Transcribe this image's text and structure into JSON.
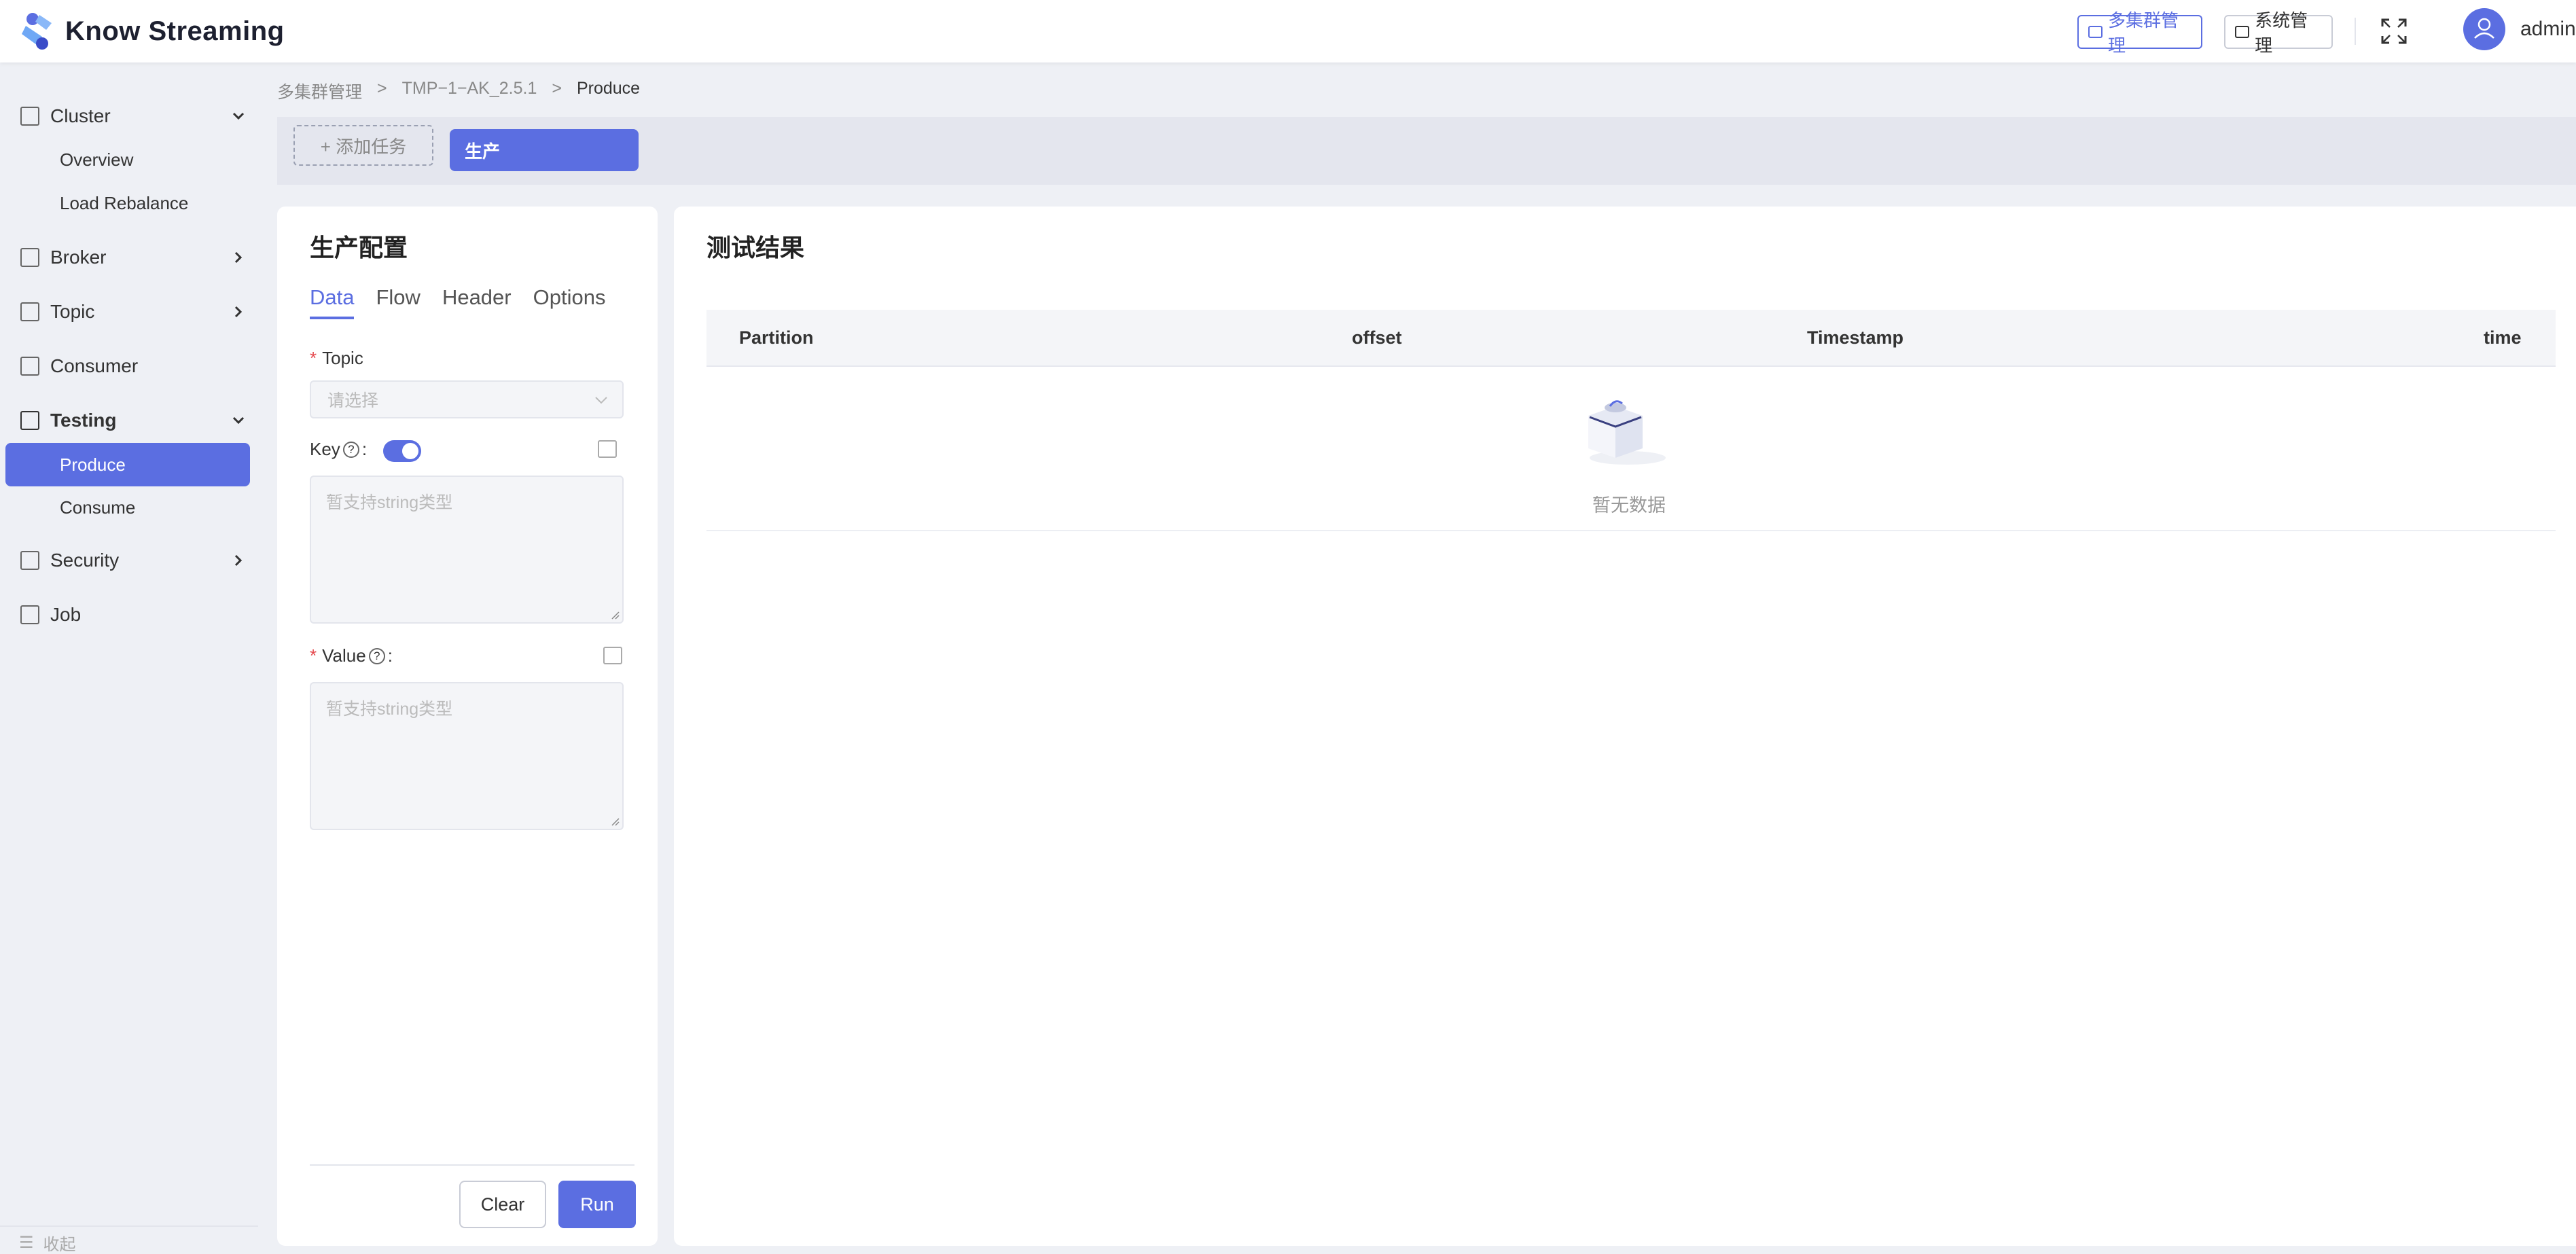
{
  "app": {
    "name": "Know Streaming"
  },
  "header": {
    "multi_cluster_btn": "多集群管理",
    "system_btn": "系统管理",
    "user": "admin"
  },
  "colors": {
    "accent": "#5b6ee1",
    "background": "#eef0f5"
  },
  "sidebar": {
    "items": [
      {
        "label": "Cluster",
        "icon": "cluster-icon",
        "expanded": true
      },
      {
        "label": "Overview"
      },
      {
        "label": "Load Rebalance"
      },
      {
        "label": "Broker",
        "icon": "broker-icon",
        "expanded": false
      },
      {
        "label": "Topic",
        "icon": "topic-icon",
        "expanded": false
      },
      {
        "label": "Consumer",
        "icon": "consumer-icon"
      },
      {
        "label": "Testing",
        "icon": "testing-icon",
        "expanded": true
      },
      {
        "label": "Produce",
        "active": true
      },
      {
        "label": "Consume"
      },
      {
        "label": "Security",
        "icon": "security-icon",
        "expanded": false
      },
      {
        "label": "Job",
        "icon": "job-icon"
      }
    ],
    "collapse_label": "收起"
  },
  "breadcrumb": {
    "items": [
      "多集群管理",
      ">",
      "TMP−1−AK_2.5.1",
      ">",
      "Produce"
    ]
  },
  "tasks": {
    "add_label": "+ 添加任务",
    "active_tab": "生产"
  },
  "produce_config": {
    "title": "生产配置",
    "tabs": [
      "Data",
      "Flow",
      "Header",
      "Options"
    ],
    "active_tab": "Data",
    "topic_label": "Topic",
    "topic_placeholder": "请选择",
    "key_label": "Key",
    "key_enabled": true,
    "key_placeholder": "暂支持string类型",
    "value_label": "Value",
    "value_placeholder": "暂支持string类型",
    "required_mark": "*",
    "help_mark": "?",
    "colon": ":",
    "clear_label": "Clear",
    "run_label": "Run"
  },
  "results": {
    "title": "测试结果",
    "columns": [
      "Partition",
      "offset",
      "Timestamp",
      "time"
    ],
    "empty_text": "暂无数据"
  }
}
